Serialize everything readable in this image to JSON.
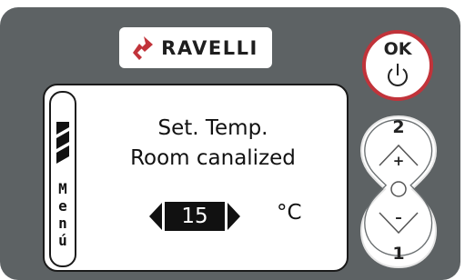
{
  "brand": {
    "name": "RAVELLI",
    "accent": "#c1333a"
  },
  "display": {
    "menu_letters": [
      "M",
      "e",
      "n",
      "ú"
    ],
    "title": "Set. Temp.",
    "subtitle": "Room canalized",
    "value": "15",
    "unit": "°C"
  },
  "buttons": {
    "ok_label": "OK",
    "up_number": "2",
    "up_symbol": "+",
    "down_symbol": "–",
    "down_number": "1"
  },
  "icons": {
    "logo": "ravelli-flame-icon",
    "power": "power-icon",
    "left": "arrow-left-icon",
    "right": "arrow-right-icon"
  }
}
